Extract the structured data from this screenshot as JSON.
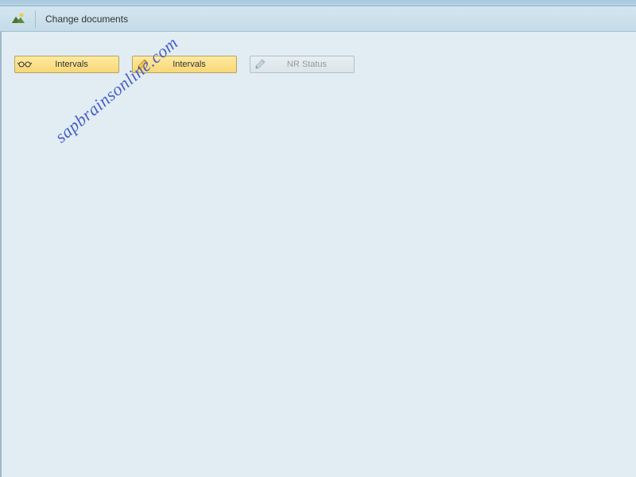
{
  "header": {
    "title": "Change documents"
  },
  "buttons": {
    "intervals_display": {
      "label": "Intervals"
    },
    "intervals_edit": {
      "label": "Intervals"
    },
    "nr_status": {
      "label": "NR Status"
    }
  },
  "watermark": "sapbrainsonline.com"
}
